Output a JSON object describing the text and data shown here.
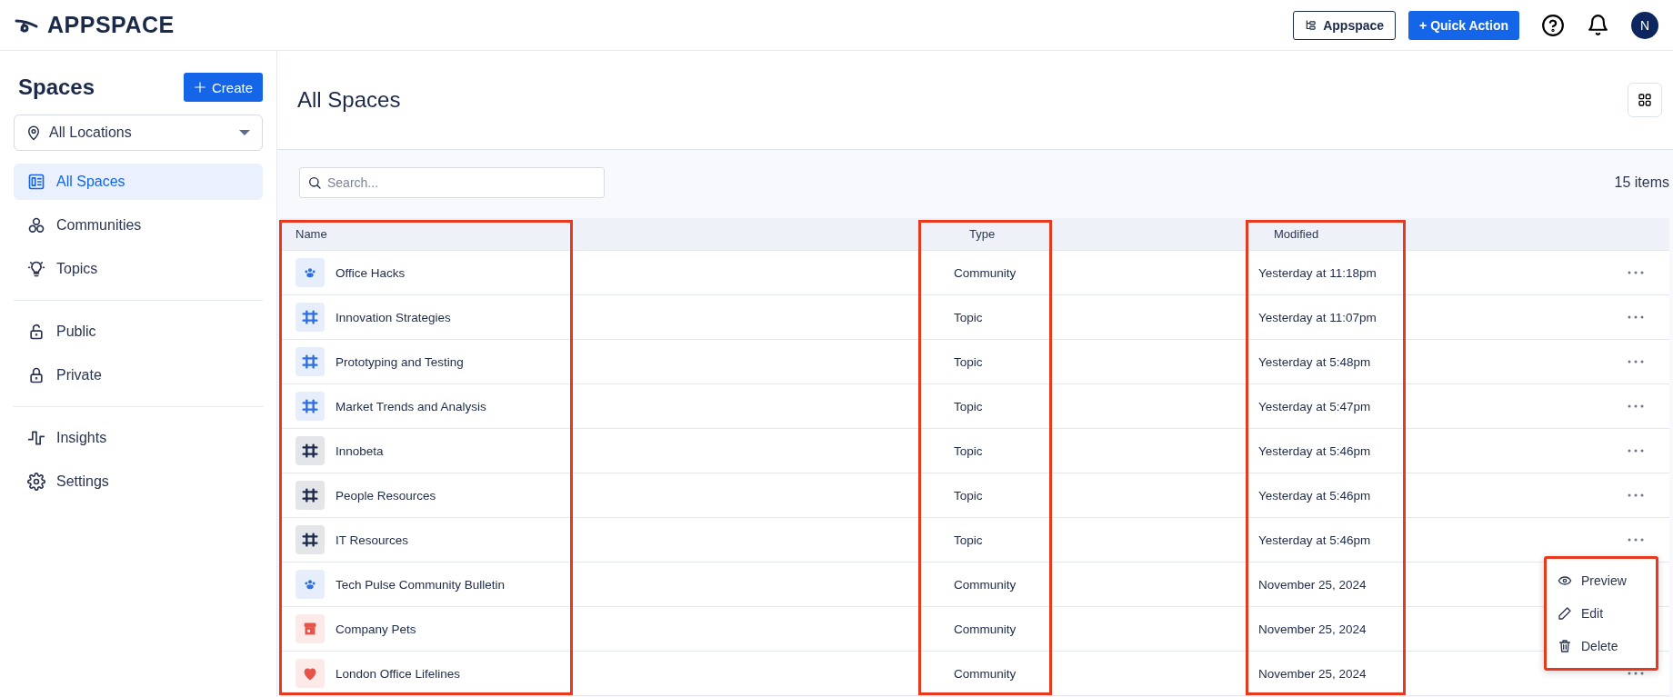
{
  "topbar": {
    "logo": "APPSPACE",
    "workspace_button": "Appspace",
    "quick_action_button": "+ Quick Action",
    "avatar": "N"
  },
  "sidebar": {
    "title": "Spaces",
    "create_button": "Create",
    "location_select": "All Locations",
    "groups": [
      [
        {
          "label": "All Spaces",
          "selected": true
        },
        {
          "label": "Communities",
          "selected": false
        },
        {
          "label": "Topics",
          "selected": false
        }
      ],
      [
        {
          "label": "Public",
          "selected": false
        },
        {
          "label": "Private",
          "selected": false
        }
      ],
      [
        {
          "label": "Insights",
          "selected": false
        },
        {
          "label": "Settings",
          "selected": false
        }
      ]
    ]
  },
  "page": {
    "title": "All Spaces",
    "search": {
      "placeholder": "Search..."
    },
    "item_count": "15 items"
  },
  "table": {
    "columns": [
      {
        "label": "Name",
        "highlighted": true
      },
      {
        "label": "Type",
        "highlighted": true
      },
      {
        "label": "Modified",
        "highlighted": true
      }
    ],
    "rows": [
      {
        "name": "Office Hacks",
        "kind": "people",
        "color": "#2f6fe0",
        "type": "Community",
        "modified": "Yesterday at 11:18pm",
        "more_button": true
      },
      {
        "name": "Innovation Strategies",
        "kind": "hash",
        "color": "#2f6fe0",
        "type": "Topic",
        "modified": "Yesterday at 11:07pm",
        "more_button": true
      },
      {
        "name": "Prototyping and Testing",
        "kind": "hash",
        "color": "#2f6fe0",
        "type": "Topic",
        "modified": "Yesterday at 5:48pm",
        "more_button": true
      },
      {
        "name": "Market Trends and Analysis",
        "kind": "hash",
        "color": "#2f6fe0",
        "type": "Topic",
        "modified": "Yesterday at 5:47pm",
        "more_button": true
      },
      {
        "name": "Innobeta",
        "kind": "hash",
        "color": "#1c2a4a",
        "type": "Topic",
        "modified": "Yesterday at 5:46pm",
        "more_button": true
      },
      {
        "name": "People Resources",
        "kind": "hash",
        "color": "#1c2a4a",
        "type": "Topic",
        "modified": "Yesterday at 5:46pm",
        "more_button": true
      },
      {
        "name": "IT Resources",
        "kind": "hash",
        "color": "#1c2a4a",
        "type": "Topic",
        "modified": "Yesterday at 5:46pm",
        "more_button": true
      },
      {
        "name": "Tech Pulse Community Bulletin",
        "kind": "people",
        "color": "#2f6fe0",
        "type": "Community",
        "modified": "November 25, 2024",
        "more_button": false
      },
      {
        "name": "Company Pets",
        "kind": "store",
        "color": "#e5534b",
        "type": "Community",
        "modified": "November 25, 2024",
        "more_button": false
      },
      {
        "name": "London Office Lifelines",
        "kind": "heart",
        "color": "#e5534b",
        "type": "Community",
        "modified": "November 25, 2024",
        "more_button": true
      }
    ]
  },
  "row_menu": {
    "highlighted": true,
    "items": [
      {
        "label": "Preview"
      },
      {
        "label": "Edit"
      },
      {
        "label": "Delete"
      }
    ]
  }
}
